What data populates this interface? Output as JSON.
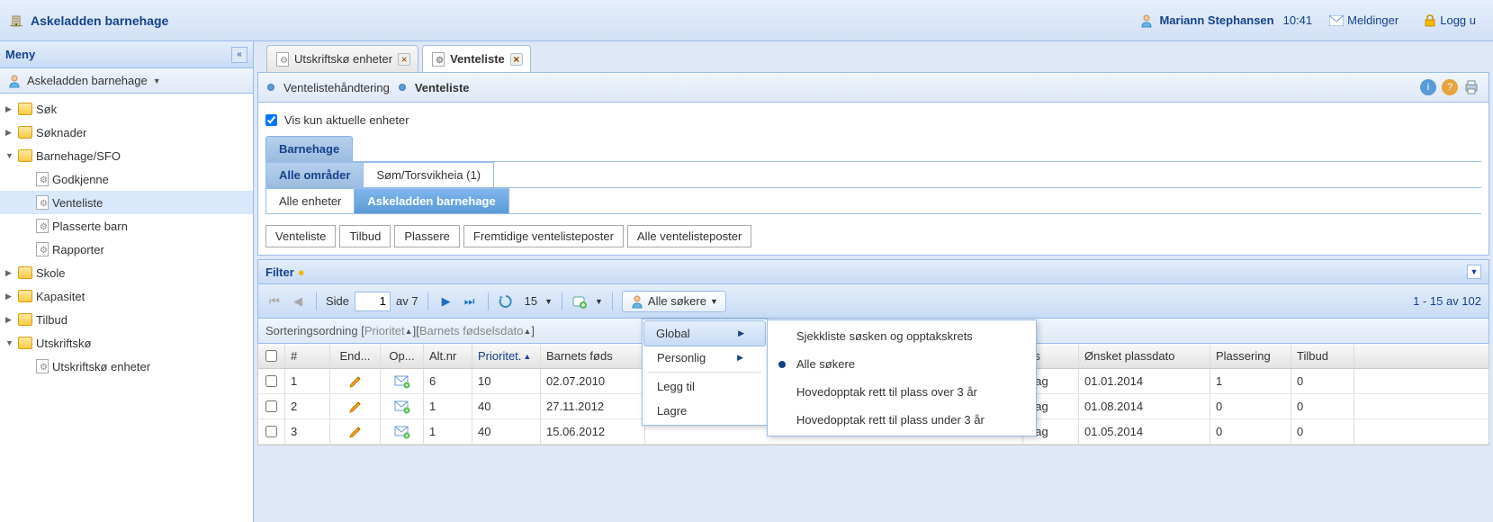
{
  "topbar": {
    "title": "Askeladden barnehage",
    "user": "Mariann Stephansen",
    "time": "10:41",
    "messages": "Meldinger",
    "logout": "Logg u"
  },
  "sidebar": {
    "title": "Meny",
    "org": "Askeladden barnehage",
    "tree": {
      "sok": "Søk",
      "soknader": "Søknader",
      "barnehage": "Barnehage/SFO",
      "godkjenne": "Godkjenne",
      "venteliste": "Venteliste",
      "plasserte": "Plasserte barn",
      "rapporter": "Rapporter",
      "skole": "Skole",
      "kapasitet": "Kapasitet",
      "tilbud": "Tilbud",
      "utskriftsko": "Utskriftskø",
      "utskriftsko_enh": "Utskriftskø enheter"
    }
  },
  "tabs": {
    "t1": "Utskriftskø enheter",
    "t2": "Venteliste"
  },
  "breadcrumb": {
    "b1": "Ventelistehåndtering",
    "b2": "Venteliste"
  },
  "filters": {
    "chk_label": "Vis kun aktuelle enheter",
    "barnehage": "Barnehage",
    "alle_omrader": "Alle områder",
    "som": "Søm/Torsvikheia  (1)",
    "alle_enheter": "Alle enheter",
    "askeladden": "Askeladden barnehage"
  },
  "subtabs": {
    "venteliste": "Venteliste",
    "tilbud": "Tilbud",
    "plassere": "Plassere",
    "fremtidige": "Fremtidige ventelisteposter",
    "alle": "Alle ventelisteposter"
  },
  "filterbar": {
    "title": "Filter"
  },
  "toolbar": {
    "side": "Side",
    "page": "1",
    "av": "av 7",
    "pagesize": "15",
    "alle_sokere": "Alle søkere",
    "count": "1 - 15 av 102"
  },
  "menu": {
    "global": "Global",
    "personlig": "Personlig",
    "legg_til": "Legg til",
    "lagre": "Lagre"
  },
  "submenu": {
    "s1": "Sjekkliste søsken og opptakskrets",
    "s2": "Alle søkere",
    "s3": "Hovedopptak rett til plass over 3 år",
    "s4": "Hovedopptak rett til plass under 3 år"
  },
  "sort": {
    "label": "Sorteringsordning",
    "p1": "Prioritet",
    "p2": "Barnets fødselsdato"
  },
  "columns": {
    "num": "#",
    "end": "End...",
    "op": "Op...",
    "alt": "Alt.nr",
    "pri": "Prioritet.",
    "fod": "Barnets føds",
    "ss": "ss",
    "dag": "dag",
    "dato": "Ønsket plassdato",
    "plass": "Plassering",
    "tilb": "Tilbud"
  },
  "rows": [
    {
      "n": "1",
      "alt": "6",
      "pri": "10",
      "fod": "02.07.2010",
      "dato": "01.01.2014",
      "plass": "1",
      "tilb": "0"
    },
    {
      "n": "2",
      "alt": "1",
      "pri": "40",
      "fod": "27.11.2012",
      "dato": "01.08.2014",
      "plass": "0",
      "tilb": "0"
    },
    {
      "n": "3",
      "alt": "1",
      "pri": "40",
      "fod": "15.06.2012",
      "dato": "01.05.2014",
      "plass": "0",
      "tilb": "0"
    }
  ]
}
